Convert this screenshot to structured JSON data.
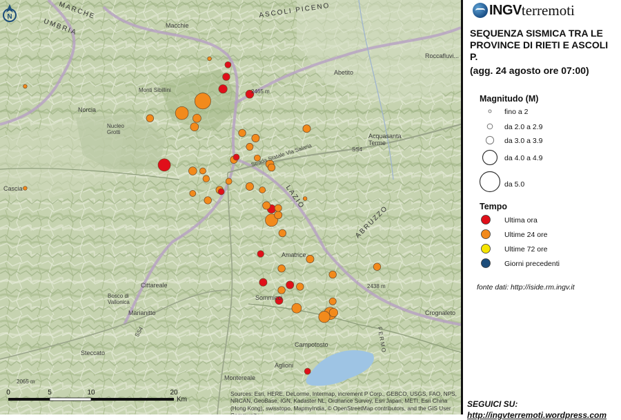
{
  "logo": {
    "part1": "INGV",
    "part2": "terremoti"
  },
  "title": "SEQUENZA SISMICA TRA LE PROVINCE DI RIETI E ASCOLI P.",
  "subtitle": "(agg. 24 agosto ore 07:00)",
  "legend": {
    "magnitude": {
      "heading": "Magnitudo (M)",
      "items": [
        {
          "label": "fino a 2"
        },
        {
          "label": "da 2.0 a 2.9"
        },
        {
          "label": "da 3.0 a 3.9"
        },
        {
          "label": "da 4.0 a 4.9"
        },
        {
          "label": "da 5.0"
        }
      ]
    },
    "time": {
      "heading": "Tempo",
      "items": [
        {
          "label": "Ultima ora",
          "color": "#e00f1a"
        },
        {
          "label": "Ultime 24 ore",
          "color": "#f28a1c"
        },
        {
          "label": "Ultime 72 ore",
          "color": "#f5e400"
        },
        {
          "label": "Giorni precedenti",
          "color": "#1d4d7a"
        }
      ]
    }
  },
  "source": "fonte dati: http://iside.rm.ingv.it",
  "follow": {
    "label": "SEGUICI SU:",
    "url": "http://ingvterremoti.wordpress.com"
  },
  "north_label": "N",
  "scale": {
    "ticks": [
      "0",
      "5",
      "10",
      "20"
    ],
    "unit": "Km"
  },
  "attribution": "Sources: Esri, HERE, DeLorme, Intermap, increment P Corp., GEBCO, USGS, FAO, NPS, NRCAN, GeoBase, IGN, Kadaster NL, Ordnance Survey, Esri Japan, METI, Esri China (Hong Kong), swisstopo, MapmyIndia, © OpenStreetMap contributors, and the GIS User Community",
  "map_labels": {
    "marche": "MARCHE",
    "umbria": "UMBRIA",
    "ascoli": "ASCOLI PICENO",
    "lazio": "LAZIO",
    "abruzzo": "ABRUZZO",
    "norcia": "Norcia",
    "cascia": "Cascia",
    "amatrice": "Amatrice",
    "cittareale": "Cittareale",
    "marianitto": "Marianitto",
    "steccato": "Steccato",
    "montereale": "Montereale",
    "aglioni": "Aglioni",
    "campotosto": "Campotosto",
    "crognaleto": "Crognaleto",
    "acquasanta": "Acquasanta Terme",
    "abetito": "Abetito",
    "roccafluvione": "Roccafluvi...",
    "macchie": "Macchie",
    "sommicci": "Sommicci",
    "salaria": "Strada Statale Via Salaria",
    "ss4a": "SS4",
    "ss4b": "SS4",
    "peak1": "2465 m",
    "peak2": "2438 m",
    "peak3": "2065 m",
    "sibillini": "Monti Sibillini",
    "bosco": "Bosco di Vallonica",
    "nucleo": "Nucleo Grotti",
    "fermo": "FERMO"
  },
  "events": [
    {
      "lat": 42.857,
      "lon": 13.236,
      "mag": 3.6,
      "time": "ultima ora"
    },
    {
      "lat": 42.871,
      "lon": 13.24,
      "mag": 3.3,
      "time": "ultima ora"
    },
    {
      "lat": 42.851,
      "lon": 13.268,
      "mag": 3.5,
      "time": "ultima ora"
    },
    {
      "lat": 42.885,
      "lon": 13.242,
      "mag": 3.0,
      "time": "ultima ora"
    },
    {
      "lat": 42.769,
      "lon": 13.166,
      "mag": 4.5,
      "time": "ultima ora"
    },
    {
      "lat": 42.738,
      "lon": 13.234,
      "mag": 3.0,
      "time": "ultima ora"
    },
    {
      "lat": 42.718,
      "lon": 13.294,
      "mag": 3.6,
      "time": "ultima ora"
    },
    {
      "lat": 42.666,
      "lon": 13.281,
      "mag": 3.1,
      "time": "ultima ora"
    },
    {
      "lat": 42.633,
      "lon": 13.284,
      "mag": 3.4,
      "time": "ultima ora"
    },
    {
      "lat": 42.63,
      "lon": 13.316,
      "mag": 3.4,
      "time": "ultima ora"
    },
    {
      "lat": 42.612,
      "lon": 13.303,
      "mag": 3.4,
      "time": "ultima ora"
    },
    {
      "lat": 42.53,
      "lon": 13.337,
      "mag": 3.0,
      "time": "ultima ora"
    },
    {
      "lat": 42.778,
      "lon": 13.252,
      "mag": 3.0,
      "time": "ultima ora"
    },
    {
      "lat": 42.843,
      "lon": 13.212,
      "mag": 5.4,
      "time": "ultime 24 ore"
    },
    {
      "lat": 42.823,
      "lon": 13.205,
      "mag": 5.0,
      "time": "ultime 24 ore"
    },
    {
      "lat": 42.829,
      "lon": 13.187,
      "mag": 4.6,
      "time": "ultime 24 ore"
    },
    {
      "lat": 42.813,
      "lon": 13.202,
      "mag": 3.5,
      "time": "ultime 24 ore"
    },
    {
      "lat": 42.806,
      "lon": 13.259,
      "mag": 3.3,
      "time": "ultime 24 ore"
    },
    {
      "lat": 42.8,
      "lon": 13.275,
      "mag": 3.4,
      "time": "ultime 24 ore"
    },
    {
      "lat": 42.79,
      "lon": 13.268,
      "mag": 3.2,
      "time": "ultime 24 ore"
    },
    {
      "lat": 42.775,
      "lon": 13.249,
      "mag": 3.3,
      "time": "ultime 24 ore"
    },
    {
      "lat": 42.777,
      "lon": 13.277,
      "mag": 3.0,
      "time": "ultime 24 ore"
    },
    {
      "lat": 42.77,
      "lon": 13.292,
      "mag": 3.5,
      "time": "ultime 24 ore"
    },
    {
      "lat": 42.766,
      "lon": 13.294,
      "mag": 3.3,
      "time": "ultime 24 ore"
    },
    {
      "lat": 42.762,
      "lon": 13.2,
      "mag": 3.5,
      "time": "ultime 24 ore"
    },
    {
      "lat": 42.762,
      "lon": 13.212,
      "mag": 3.0,
      "time": "ultime 24 ore"
    },
    {
      "lat": 42.753,
      "lon": 13.216,
      "mag": 3.1,
      "time": "ultime 24 ore"
    },
    {
      "lat": 42.75,
      "lon": 13.243,
      "mag": 3.0,
      "time": "ultime 24 ore"
    },
    {
      "lat": 42.744,
      "lon": 13.268,
      "mag": 3.4,
      "time": "ultime 24 ore"
    },
    {
      "lat": 42.74,
      "lon": 13.232,
      "mag": 3.3,
      "time": "ultime 24 ore"
    },
    {
      "lat": 42.74,
      "lon": 13.283,
      "mag": 3.0,
      "time": "ultime 24 ore"
    },
    {
      "lat": 42.736,
      "lon": 13.2,
      "mag": 3.0,
      "time": "ultime 24 ore"
    },
    {
      "lat": 42.728,
      "lon": 13.218,
      "mag": 3.3,
      "time": "ultime 24 ore"
    },
    {
      "lat": 42.722,
      "lon": 13.288,
      "mag": 3.4,
      "time": "ultime 24 ore"
    },
    {
      "lat": 42.719,
      "lon": 13.302,
      "mag": 3.2,
      "time": "ultime 24 ore"
    },
    {
      "lat": 42.711,
      "lon": 13.302,
      "mag": 3.4,
      "time": "ultime 24 ore"
    },
    {
      "lat": 42.705,
      "lon": 13.294,
      "mag": 4.5,
      "time": "ultime 24 ore"
    },
    {
      "lat": 42.69,
      "lon": 13.307,
      "mag": 3.3,
      "time": "ultime 24 ore"
    },
    {
      "lat": 42.811,
      "lon": 13.336,
      "mag": 3.4,
      "time": "ultime 24 ore"
    },
    {
      "lat": 42.823,
      "lon": 13.149,
      "mag": 3.3,
      "time": "ultime 24 ore"
    },
    {
      "lat": 42.66,
      "lon": 13.34,
      "mag": 3.4,
      "time": "ultime 24 ore"
    },
    {
      "lat": 42.649,
      "lon": 13.306,
      "mag": 3.3,
      "time": "ultime 24 ore"
    },
    {
      "lat": 42.642,
      "lon": 13.367,
      "mag": 3.3,
      "time": "ultime 24 ore"
    },
    {
      "lat": 42.651,
      "lon": 13.42,
      "mag": 3.3,
      "time": "ultime 24 ore"
    },
    {
      "lat": 42.628,
      "lon": 13.328,
      "mag": 3.3,
      "time": "ultime 24 ore"
    },
    {
      "lat": 42.624,
      "lon": 13.306,
      "mag": 3.3,
      "time": "ultime 24 ore"
    },
    {
      "lat": 42.611,
      "lon": 13.367,
      "mag": 3.2,
      "time": "ultime 24 ore"
    },
    {
      "lat": 42.603,
      "lon": 13.324,
      "mag": 4.0,
      "time": "ultime 24 ore"
    },
    {
      "lat": 42.597,
      "lon": 13.364,
      "mag": 4.5,
      "time": "ultime 24 ore"
    },
    {
      "lat": 42.593,
      "lon": 13.357,
      "mag": 4.3,
      "time": "ultime 24 ore"
    },
    {
      "lat": 42.598,
      "lon": 13.368,
      "mag": 3.6,
      "time": "ultime 24 ore"
    },
    {
      "lat": 42.73,
      "lon": 13.334,
      "mag": 2.2,
      "time": "ultime 24 ore"
    },
    {
      "lat": 42.892,
      "lon": 13.22,
      "mag": 2.2,
      "time": "ultime 24 ore"
    },
    {
      "lat": 42.742,
      "lon": 13.0,
      "mag": 2.2,
      "time": "ultime 24 ore"
    },
    {
      "lat": 42.86,
      "lon": 13.0,
      "mag": 2.2,
      "time": "ultime 24 ore"
    }
  ]
}
